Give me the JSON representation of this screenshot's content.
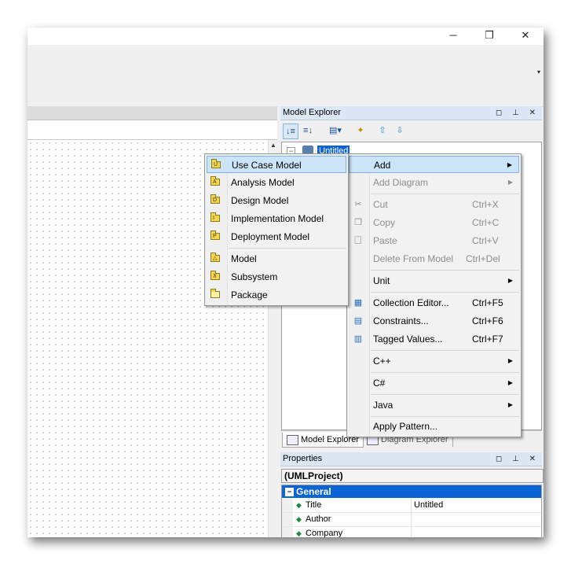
{
  "window": {
    "controls": {
      "minimize": "─",
      "restore": "❐",
      "close": "✕"
    },
    "ribbon_dropdown": "▾"
  },
  "model_explorer": {
    "title": "Model Explorer",
    "header_buttons": "◻ ⊥ ✕",
    "tree_root": "Untitled",
    "tree_expander": "−",
    "toolbar": {
      "sort_az": "↓≡",
      "sort_za": "≡↓",
      "view_menu": "▤▾",
      "tool": "✦",
      "up": "⇧",
      "down": "⇩"
    }
  },
  "explorer_tabs": {
    "model_explorer": "Model Explorer",
    "diagram_explorer": "Diagram Explorer"
  },
  "properties": {
    "title": "Properties",
    "header_buttons": "◻ ⊥ ✕",
    "selection": "(UMLProject)",
    "category": "General",
    "category_toggle": "−",
    "rows": [
      {
        "name": "Title",
        "value": "Untitled"
      },
      {
        "name": "Author",
        "value": ""
      },
      {
        "name": "Company",
        "value": ""
      }
    ]
  },
  "diagram": {
    "scroll_up": "▲"
  },
  "context_menu": {
    "items": [
      {
        "label": "Add",
        "shortcut": "",
        "has_submenu": true,
        "disabled": false,
        "highlighted": true
      },
      {
        "label": "Add Diagram",
        "shortcut": "",
        "has_submenu": true,
        "disabled": true
      },
      {
        "label": "Cut",
        "shortcut": "Ctrl+X",
        "disabled": true,
        "icon": "scissors-icon"
      },
      {
        "label": "Copy",
        "shortcut": "Ctrl+C",
        "disabled": true,
        "icon": "copy-icon"
      },
      {
        "label": "Paste",
        "shortcut": "Ctrl+V",
        "disabled": true,
        "icon": "paste-icon"
      },
      {
        "label": "Delete From Model",
        "shortcut": "Ctrl+Del",
        "disabled": true
      },
      {
        "label": "Unit",
        "shortcut": "",
        "has_submenu": true,
        "disabled": false
      },
      {
        "label": "Collection Editor...",
        "shortcut": "Ctrl+F5",
        "disabled": false,
        "icon": "collection-editor-icon"
      },
      {
        "label": "Constraints...",
        "shortcut": "Ctrl+F6",
        "disabled": false,
        "icon": "constraints-icon"
      },
      {
        "label": "Tagged Values...",
        "shortcut": "Ctrl+F7",
        "disabled": false,
        "icon": "tagged-values-icon"
      },
      {
        "label": "C++",
        "shortcut": "",
        "has_submenu": true,
        "disabled": false
      },
      {
        "label": "C#",
        "shortcut": "",
        "has_submenu": true,
        "disabled": false
      },
      {
        "label": "Java",
        "shortcut": "",
        "has_submenu": true,
        "disabled": false
      },
      {
        "label": "Apply Pattern...",
        "shortcut": "",
        "disabled": false
      }
    ],
    "arrow": "▶",
    "icons": {
      "scissors": "✂",
      "copy": "❐",
      "paste": "📋",
      "editor": "▦",
      "constraints": "▤",
      "tagged": "▥"
    }
  },
  "add_submenu": {
    "items": [
      {
        "label": "Use Case Model",
        "highlighted": true,
        "icon_letter": "U"
      },
      {
        "label": "Analysis Model",
        "icon_letter": "A"
      },
      {
        "label": "Design Model",
        "icon_letter": "D"
      },
      {
        "label": "Implementation Model",
        "icon_letter": "I"
      },
      {
        "label": "Deployment Model",
        "icon_letter": "P"
      },
      {
        "label": "Model",
        "icon_letter": "△"
      },
      {
        "label": "Subsystem",
        "icon_letter": "⊼"
      },
      {
        "label": "Package",
        "icon_letter": ""
      }
    ]
  },
  "colors": {
    "selection_blue": "#0a64d6",
    "menu_highlight": "#cce4f7",
    "panel_header": "#dce7f5",
    "folder_yellow": "#f5d54a"
  }
}
